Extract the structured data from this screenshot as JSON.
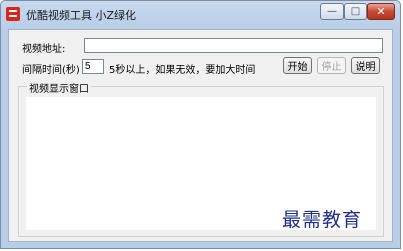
{
  "window": {
    "title": "优酷视频工具 小Z绿化",
    "controls": {
      "minimize": "—",
      "maximize": "□",
      "close": "✕"
    }
  },
  "form": {
    "url_label": "视频地址:",
    "url_value": "",
    "interval_label": "间隔时间(秒)",
    "interval_value": "5",
    "interval_hint": "5秒以上，如果无效，要加大时间",
    "start_label": "开始",
    "stop_label": "停止",
    "help_label": "说明"
  },
  "display": {
    "group_title": "视频显示窗口"
  },
  "watermark": "最需教育",
  "icons": [
    "app-icon",
    "minimize-icon",
    "maximize-icon",
    "close-icon"
  ]
}
